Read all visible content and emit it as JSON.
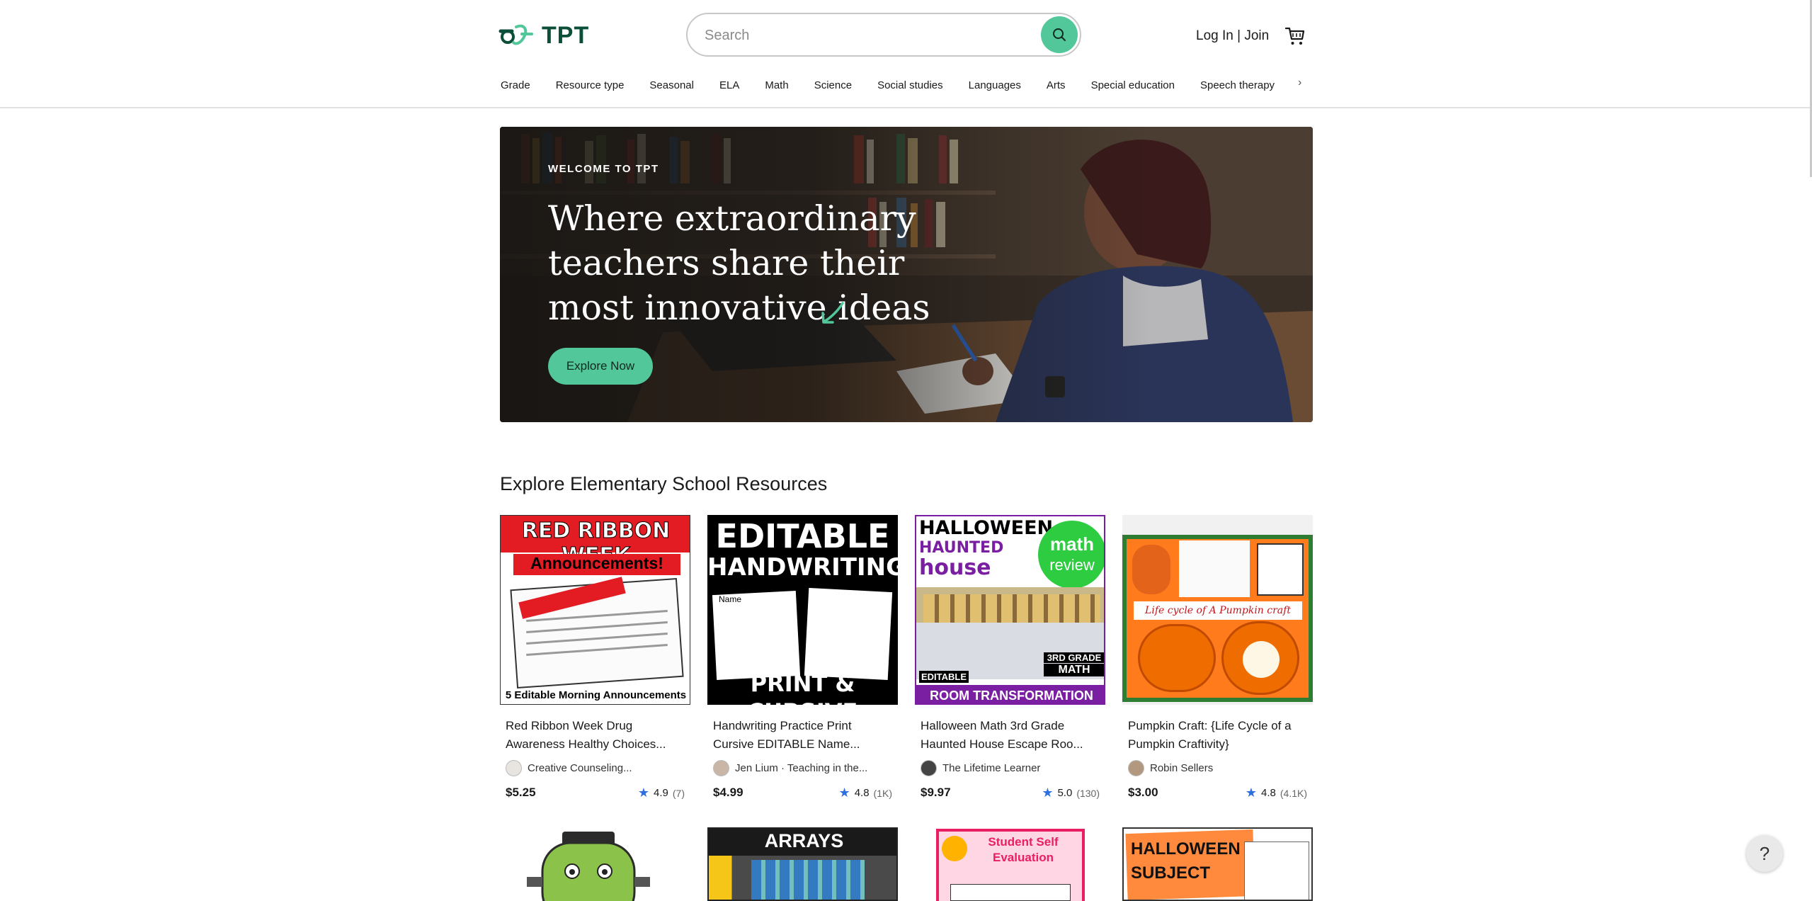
{
  "brand": {
    "name": "TPT",
    "color": "#0b4f3b",
    "accent": "#52c79a"
  },
  "search": {
    "placeholder": "Search",
    "value": ""
  },
  "account": {
    "login_label": "Log In | Join"
  },
  "nav": {
    "items": [
      "Grade",
      "Resource type",
      "Seasonal",
      "ELA",
      "Math",
      "Science",
      "Social studies",
      "Languages",
      "Arts",
      "Special education",
      "Speech therapy"
    ],
    "more_chevron": "›"
  },
  "hero": {
    "eyebrow": "WELCOME TO TPT",
    "title": "Where extraordinary teachers share their most innovative ideas",
    "cta_label": "Explore Now"
  },
  "section": {
    "title": "Explore Elementary School Resources"
  },
  "products": [
    {
      "title": "Red Ribbon Week Drug Awareness Healthy Choices...",
      "seller": "Creative Counseling...",
      "price": "$5.25",
      "rating": "4.9",
      "rating_count": "(7)",
      "thumb_text": {
        "line1": "RED RIBBON WEEK",
        "line2": "Announcements!",
        "line3": "5 Editable Morning Announcements"
      }
    },
    {
      "title": "Handwriting Practice Print Cursive EDITABLE Name...",
      "seller": "Jen Lium · Teaching in the...",
      "price": "$4.99",
      "rating": "4.8",
      "rating_count": "(1K)",
      "thumb_text": {
        "line1": "EDITABLE",
        "line2": "HANDWRITING",
        "line3": "PRINT & CURSIVE",
        "line4": "Name"
      }
    },
    {
      "title": "Halloween Math 3rd Grade Haunted House Escape Roo...",
      "seller": "The Lifetime Learner",
      "price": "$9.97",
      "rating": "5.0",
      "rating_count": "(130)",
      "thumb_text": {
        "line1": "HALLOWEEN",
        "line2": "HAUNTED",
        "line3": "house",
        "badge1": "math",
        "badge2": "review",
        "tag1": "EDITABLE",
        "tag2": "3RD GRADE",
        "tag3": "MATH",
        "footer": "ROOM TRANSFORMATION"
      }
    },
    {
      "title": "Pumpkin Craft: {Life Cycle of a Pumpkin Craftivity}",
      "seller": "Robin Sellers",
      "price": "$3.00",
      "rating": "4.8",
      "rating_count": "(4.1K)",
      "thumb_text": {
        "line1": "Life cycle of A Pumpkin craft"
      }
    }
  ],
  "row2": [
    {
      "thumb_text": ""
    },
    {
      "thumb_text": "ARRAYS CRAFTIVITY"
    },
    {
      "thumb_text": "Student Self Evaluation"
    },
    {
      "thumb_text": "HALLOWEEN SUBJECT"
    }
  ],
  "help": {
    "label": "?"
  }
}
